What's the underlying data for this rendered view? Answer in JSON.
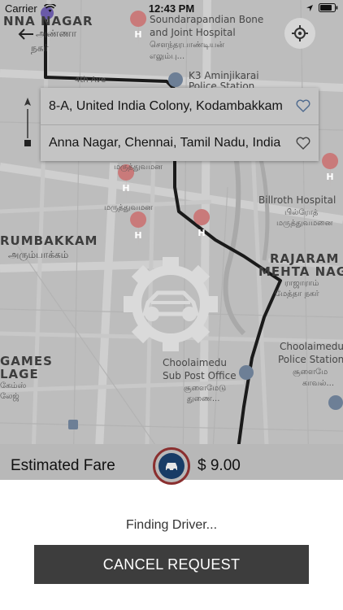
{
  "status_bar": {
    "carrier": "Carrier",
    "time": "12:43 PM",
    "icons": [
      "wifi-icon",
      "location-arrow-icon",
      "battery-icon"
    ]
  },
  "map": {
    "labels": {
      "anna_nagar_en": "NNA NAGAR",
      "anna_nagar_ta1": "அண்ணா",
      "anna_nagar_ta2": "நகர்",
      "hospital_line1": "Soundarapandian Bone",
      "hospital_line2": "and Joint Hospital",
      "hospital_ta1": "சௌந்தரபாண்டியன்",
      "hospital_ta2": "எலும்பு...",
      "fourth_ave": "4th Ave",
      "k3_line1": "K3 Aminjikarai",
      "k3_line2": "Police Station",
      "billroth_line1": "Billroth Hospital",
      "billroth_ta1": "பில்ரோத்",
      "billroth_ta2": "மருத்துவமனை",
      "arumbakkam_en": "RUMBAKKAM",
      "arumbakkam_ta": "அரும்பாக்கம்",
      "rajaram_line1": "RAJARAM",
      "rajaram_line2": "MEHTA NAGAR",
      "rajaram_ta1": "ராஜாராம்",
      "rajaram_ta2": "மேத்தா நகர்",
      "games_line1": "GAMES",
      "games_line2": "LAGE",
      "games_ta1": "கேம்ஸ்",
      "games_ta2": "லேஜ்",
      "choolaimedu_po1": "Choolaimedu",
      "choolaimedu_po2": "Sub Post Office",
      "choolaimedu_po_ta1": "சூளைமேடு",
      "choolaimedu_po_ta2": "துணை...",
      "choolaimedu_ps1": "Choolaimedu",
      "choolaimedu_ps2": "Police Station",
      "choolaimedu_ps_ta1": "சூளைமே",
      "choolaimedu_ps_ta2": "காவல்...",
      "hospital_ta_small1": "மருத்துவமன",
      "hospital_ta_small2": "மருத்துவமன"
    }
  },
  "route": {
    "pickup": "8-A, United India Colony, Kodambakkam",
    "dropoff": "Anna Nagar, Chennai, Tamil Nadu, India"
  },
  "fare": {
    "label": "Estimated Fare",
    "amount": "$ 9.00"
  },
  "sheet": {
    "status": "Finding Driver...",
    "cancel_label": "CANCEL REQUEST"
  },
  "colors": {
    "overlay": "#bdbdbd",
    "route_line": "#1a1a1a",
    "button_bg": "#3d3d3d",
    "fare_icon_ring": "#8a2f2f",
    "fare_icon_inner": "#183c66"
  }
}
